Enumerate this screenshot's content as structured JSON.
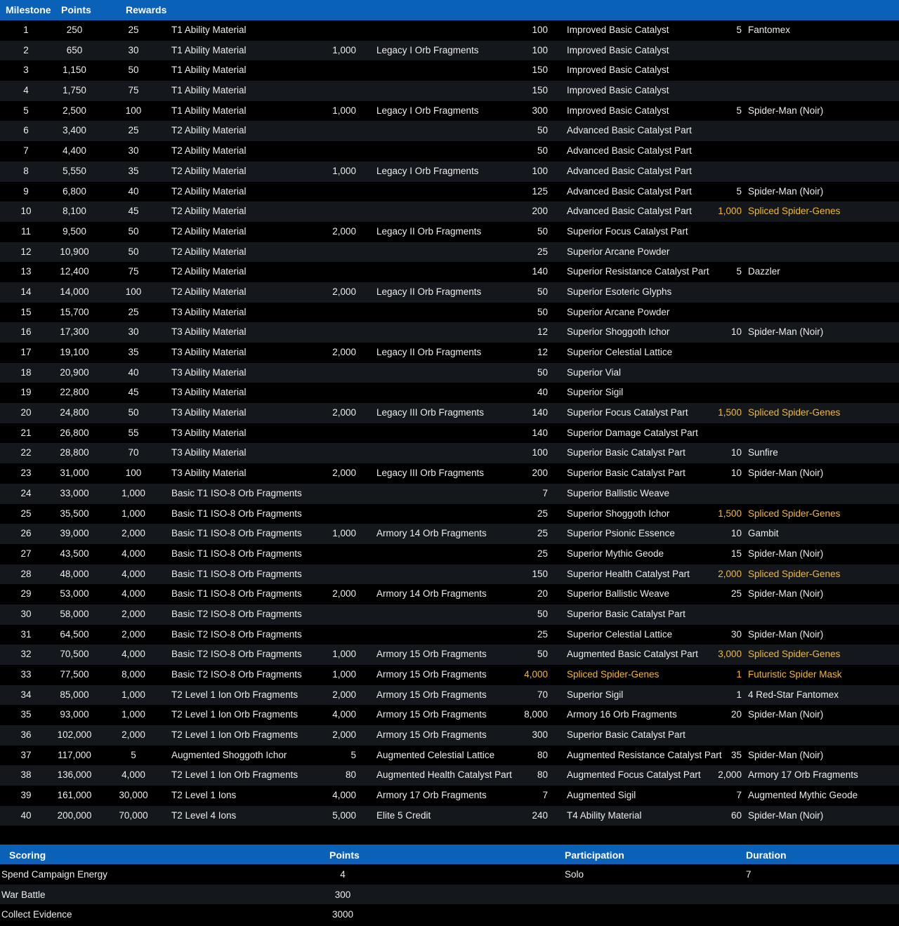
{
  "header": {
    "milestone": "Milestone",
    "points": "Points",
    "rewards": "Rewards"
  },
  "rows": [
    {
      "m": "1",
      "p": "250",
      "r1q": "25",
      "r1": "T1 Ability Material",
      "r2q": "",
      "r2": "",
      "r3q": "100",
      "r3": "Improved Basic Catalyst",
      "r4q": "5",
      "r4": "Fantomex"
    },
    {
      "m": "2",
      "p": "650",
      "r1q": "30",
      "r1": "T1 Ability Material",
      "r2q": "1,000",
      "r2": "Legacy I Orb Fragments",
      "r3q": "100",
      "r3": "Improved Basic Catalyst",
      "r4q": "",
      "r4": ""
    },
    {
      "m": "3",
      "p": "1,150",
      "r1q": "50",
      "r1": "T1 Ability Material",
      "r2q": "",
      "r2": "",
      "r3q": "150",
      "r3": "Improved Basic Catalyst",
      "r4q": "",
      "r4": ""
    },
    {
      "m": "4",
      "p": "1,750",
      "r1q": "75",
      "r1": "T1 Ability Material",
      "r2q": "",
      "r2": "",
      "r3q": "150",
      "r3": "Improved Basic Catalyst",
      "r4q": "",
      "r4": ""
    },
    {
      "m": "5",
      "p": "2,500",
      "r1q": "100",
      "r1": "T1 Ability Material",
      "r2q": "1,000",
      "r2": "Legacy I Orb Fragments",
      "r3q": "300",
      "r3": "Improved Basic Catalyst",
      "r4q": "5",
      "r4": "Spider-Man (Noir)"
    },
    {
      "m": "6",
      "p": "3,400",
      "r1q": "25",
      "r1": "T2 Ability Material",
      "r2q": "",
      "r2": "",
      "r3q": "50",
      "r3": "Advanced Basic Catalyst Part",
      "r4q": "",
      "r4": ""
    },
    {
      "m": "7",
      "p": "4,400",
      "r1q": "30",
      "r1": "T2 Ability Material",
      "r2q": "",
      "r2": "",
      "r3q": "50",
      "r3": "Advanced Basic Catalyst Part",
      "r4q": "",
      "r4": ""
    },
    {
      "m": "8",
      "p": "5,550",
      "r1q": "35",
      "r1": "T2 Ability Material",
      "r2q": "1,000",
      "r2": "Legacy I Orb Fragments",
      "r3q": "100",
      "r3": "Advanced Basic Catalyst Part",
      "r4q": "",
      "r4": ""
    },
    {
      "m": "9",
      "p": "6,800",
      "r1q": "40",
      "r1": "T2 Ability Material",
      "r2q": "",
      "r2": "",
      "r3q": "125",
      "r3": "Advanced Basic Catalyst Part",
      "r4q": "5",
      "r4": "Spider-Man (Noir)"
    },
    {
      "m": "10",
      "p": "8,100",
      "r1q": "45",
      "r1": "T2 Ability Material",
      "r2q": "",
      "r2": "",
      "r3q": "200",
      "r3": "Advanced Basic Catalyst Part",
      "r4q": "1,000",
      "r4": "Spliced Spider-Genes",
      "g4": true
    },
    {
      "m": "11",
      "p": "9,500",
      "r1q": "50",
      "r1": "T2 Ability Material",
      "r2q": "2,000",
      "r2": "Legacy II Orb Fragments",
      "r3q": "50",
      "r3": "Superior Focus Catalyst Part",
      "r4q": "",
      "r4": ""
    },
    {
      "m": "12",
      "p": "10,900",
      "r1q": "50",
      "r1": "T2 Ability Material",
      "r2q": "",
      "r2": "",
      "r3q": "25",
      "r3": "Superior Arcane Powder",
      "r4q": "",
      "r4": ""
    },
    {
      "m": "13",
      "p": "12,400",
      "r1q": "75",
      "r1": "T2 Ability Material",
      "r2q": "",
      "r2": "",
      "r3q": "140",
      "r3": "Superior Resistance Catalyst Part",
      "r4q": "5",
      "r4": "Dazzler"
    },
    {
      "m": "14",
      "p": "14,000",
      "r1q": "100",
      "r1": "T2 Ability Material",
      "r2q": "2,000",
      "r2": "Legacy II Orb Fragments",
      "r3q": "50",
      "r3": "Superior Esoteric Glyphs",
      "r4q": "",
      "r4": ""
    },
    {
      "m": "15",
      "p": "15,700",
      "r1q": "25",
      "r1": "T3 Ability Material",
      "r2q": "",
      "r2": "",
      "r3q": "50",
      "r3": "Superior Arcane Powder",
      "r4q": "",
      "r4": ""
    },
    {
      "m": "16",
      "p": "17,300",
      "r1q": "30",
      "r1": "T3 Ability Material",
      "r2q": "",
      "r2": "",
      "r3q": "12",
      "r3": "Superior Shoggoth Ichor",
      "r4q": "10",
      "r4": "Spider-Man (Noir)"
    },
    {
      "m": "17",
      "p": "19,100",
      "r1q": "35",
      "r1": "T3 Ability Material",
      "r2q": "2,000",
      "r2": "Legacy II Orb Fragments",
      "r3q": "12",
      "r3": "Superior Celestial Lattice",
      "r4q": "",
      "r4": ""
    },
    {
      "m": "18",
      "p": "20,900",
      "r1q": "40",
      "r1": "T3 Ability Material",
      "r2q": "",
      "r2": "",
      "r3q": "50",
      "r3": "Superior Vial",
      "r4q": "",
      "r4": ""
    },
    {
      "m": "19",
      "p": "22,800",
      "r1q": "45",
      "r1": "T3 Ability Material",
      "r2q": "",
      "r2": "",
      "r3q": "40",
      "r3": "Superior Sigil",
      "r4q": "",
      "r4": ""
    },
    {
      "m": "20",
      "p": "24,800",
      "r1q": "50",
      "r1": "T3 Ability Material",
      "r2q": "2,000",
      "r2": "Legacy III Orb Fragments",
      "r3q": "140",
      "r3": "Superior Focus Catalyst Part",
      "r4q": "1,500",
      "r4": "Spliced Spider-Genes",
      "g4": true
    },
    {
      "m": "21",
      "p": "26,800",
      "r1q": "55",
      "r1": "T3 Ability Material",
      "r2q": "",
      "r2": "",
      "r3q": "140",
      "r3": "Superior Damage Catalyst Part",
      "r4q": "",
      "r4": ""
    },
    {
      "m": "22",
      "p": "28,800",
      "r1q": "70",
      "r1": "T3 Ability Material",
      "r2q": "",
      "r2": "",
      "r3q": "100",
      "r3": "Superior Basic Catalyst Part",
      "r4q": "10",
      "r4": "Sunfire"
    },
    {
      "m": "23",
      "p": "31,000",
      "r1q": "100",
      "r1": "T3 Ability Material",
      "r2q": "2,000",
      "r2": "Legacy III Orb Fragments",
      "r3q": "200",
      "r3": "Superior Basic Catalyst Part",
      "r4q": "10",
      "r4": "Spider-Man (Noir)"
    },
    {
      "m": "24",
      "p": "33,000",
      "r1q": "1,000",
      "r1": "Basic T1 ISO-8 Orb Fragments",
      "r2q": "",
      "r2": "",
      "r3q": "7",
      "r3": "Superior Ballistic Weave",
      "r4q": "",
      "r4": ""
    },
    {
      "m": "25",
      "p": "35,500",
      "r1q": "1,000",
      "r1": "Basic T1 ISO-8 Orb Fragments",
      "r2q": "",
      "r2": "",
      "r3q": "25",
      "r3": "Superior Shoggoth Ichor",
      "r4q": "1,500",
      "r4": "Spliced Spider-Genes",
      "g4": true
    },
    {
      "m": "26",
      "p": "39,000",
      "r1q": "2,000",
      "r1": "Basic T1 ISO-8 Orb Fragments",
      "r2q": "1,000",
      "r2": "Armory 14 Orb Fragments",
      "r3q": "25",
      "r3": "Superior Psionic Essence",
      "r4q": "10",
      "r4": "Gambit"
    },
    {
      "m": "27",
      "p": "43,500",
      "r1q": "4,000",
      "r1": "Basic T1 ISO-8 Orb Fragments",
      "r2q": "",
      "r2": "",
      "r3q": "25",
      "r3": "Superior Mythic Geode",
      "r4q": "15",
      "r4": "Spider-Man (Noir)"
    },
    {
      "m": "28",
      "p": "48,000",
      "r1q": "4,000",
      "r1": "Basic T1 ISO-8 Orb Fragments",
      "r2q": "",
      "r2": "",
      "r3q": "150",
      "r3": "Superior Health Catalyst Part",
      "r4q": "2,000",
      "r4": "Spliced Spider-Genes",
      "g4": true
    },
    {
      "m": "29",
      "p": "53,000",
      "r1q": "4,000",
      "r1": "Basic T1 ISO-8 Orb Fragments",
      "r2q": "2,000",
      "r2": "Armory 14 Orb Fragments",
      "r3q": "20",
      "r3": "Superior Ballistic Weave",
      "r4q": "25",
      "r4": "Spider-Man (Noir)"
    },
    {
      "m": "30",
      "p": "58,000",
      "r1q": "2,000",
      "r1": "Basic T2 ISO-8 Orb Fragments",
      "r2q": "",
      "r2": "",
      "r3q": "50",
      "r3": "Superior Basic Catalyst Part",
      "r4q": "",
      "r4": ""
    },
    {
      "m": "31",
      "p": "64,500",
      "r1q": "2,000",
      "r1": "Basic T2 ISO-8 Orb Fragments",
      "r2q": "",
      "r2": "",
      "r3q": "25",
      "r3": "Superior Celestial Lattice",
      "r4q": "30",
      "r4": "Spider-Man (Noir)"
    },
    {
      "m": "32",
      "p": "70,500",
      "r1q": "4,000",
      "r1": "Basic T2 ISO-8 Orb Fragments",
      "r2q": "1,000",
      "r2": "Armory 15 Orb Fragments",
      "r3q": "50",
      "r3": "Augmented Basic Catalyst Part",
      "r4q": "3,000",
      "r4": "Spliced Spider-Genes",
      "g4": true
    },
    {
      "m": "33",
      "p": "77,500",
      "r1q": "8,000",
      "r1": "Basic T2 ISO-8 Orb Fragments",
      "r2q": "1,000",
      "r2": "Armory 15 Orb Fragments",
      "r3q": "4,000",
      "r3": "Spliced Spider-Genes",
      "g3": true,
      "r4q": "1",
      "r4": "Futuristic Spider Mask",
      "g4": true
    },
    {
      "m": "34",
      "p": "85,000",
      "r1q": "1,000",
      "r1": "T2 Level 1 Ion Orb Fragments",
      "r2q": "2,000",
      "r2": "Armory 15 Orb Fragments",
      "r3q": "70",
      "r3": "Superior Sigil",
      "r4q": "1",
      "r4": "4 Red-Star Fantomex"
    },
    {
      "m": "35",
      "p": "93,000",
      "r1q": "1,000",
      "r1": "T2 Level 1 Ion Orb Fragments",
      "r2q": "4,000",
      "r2": "Armory 15 Orb Fragments",
      "r3q": "8,000",
      "r3": "Armory 16 Orb Fragments",
      "r4q": "20",
      "r4": "Spider-Man (Noir)"
    },
    {
      "m": "36",
      "p": "102,000",
      "r1q": "2,000",
      "r1": "T2 Level 1 Ion Orb Fragments",
      "r2q": "2,000",
      "r2": "Armory 15 Orb Fragments",
      "r3q": "300",
      "r3": "Superior Basic Catalyst Part",
      "r4q": "",
      "r4": ""
    },
    {
      "m": "37",
      "p": "117,000",
      "r1q": "5",
      "r1": "Augmented Shoggoth Ichor",
      "r2q": "5",
      "r2": "Augmented Celestial Lattice",
      "r3q": "80",
      "r3": "Augmented Resistance Catalyst Part",
      "r4q": "35",
      "r4": "Spider-Man (Noir)"
    },
    {
      "m": "38",
      "p": "136,000",
      "r1q": "4,000",
      "r1": "T2 Level 1 Ion Orb Fragments",
      "r2q": "80",
      "r2": "Augmented Health Catalyst Part",
      "r3q": "80",
      "r3": "Augmented Focus Catalyst Part",
      "r4q": "2,000",
      "r4": "Armory 17 Orb Fragments"
    },
    {
      "m": "39",
      "p": "161,000",
      "r1q": "30,000",
      "r1": "T2 Level 1 Ions",
      "r2q": "4,000",
      "r2": "Armory 17 Orb Fragments",
      "r3q": "7",
      "r3": "Augmented Sigil",
      "r4q": "7",
      "r4": "Augmented Mythic Geode"
    },
    {
      "m": "40",
      "p": "200,000",
      "r1q": "70,000",
      "r1": "T2 Level 4 Ions",
      "r2q": "5,000",
      "r2": "Elite 5 Credit",
      "r3q": "240",
      "r3": "T4 Ability Material",
      "r4q": "60",
      "r4": "Spider-Man (Noir)"
    }
  ],
  "scoring": {
    "header": {
      "scoring": "Scoring",
      "points": "Points",
      "participation": "Participation",
      "duration": "Duration"
    },
    "rows": [
      {
        "action": "Spend Campaign Energy",
        "points": "4",
        "participation": "Solo",
        "duration": "7"
      },
      {
        "action": "War Battle",
        "points": "300",
        "participation": "",
        "duration": ""
      },
      {
        "action": "Collect Evidence",
        "points": "3000",
        "participation": "",
        "duration": ""
      }
    ]
  },
  "colors": {
    "header_bg": "#0a61b8",
    "row_alt": "#14181c",
    "highlight": "#f5b82e"
  }
}
